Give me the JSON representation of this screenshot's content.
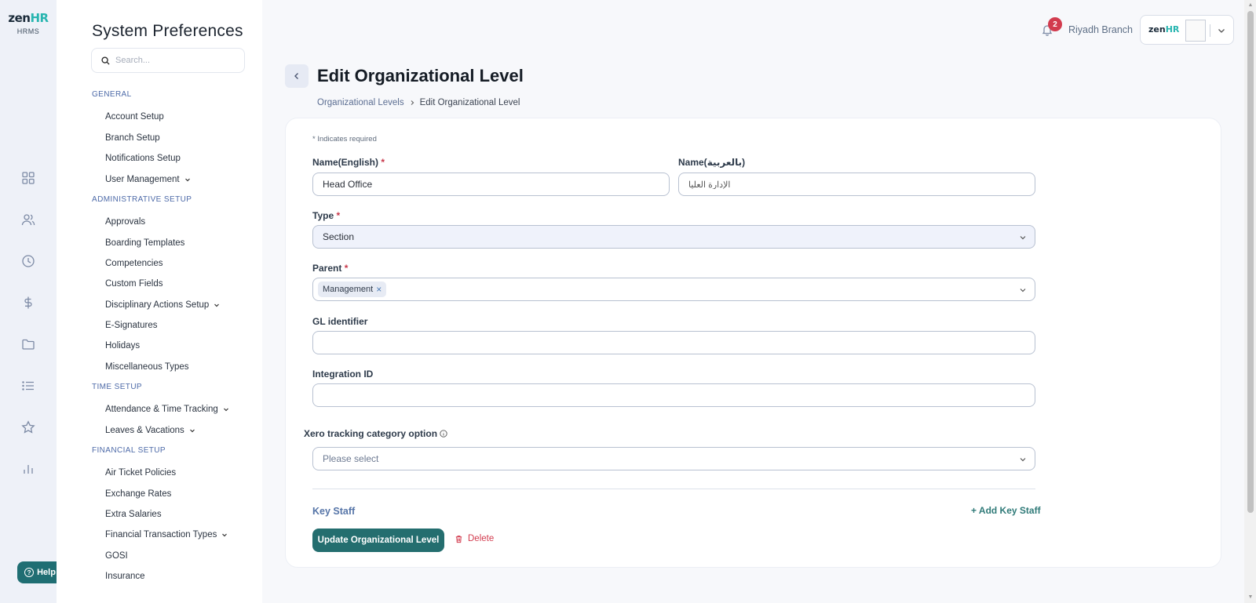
{
  "brand": {
    "logo_main": "zen",
    "logo_accent": "HR",
    "logo_sub": "HRMS"
  },
  "rail": {
    "items": [
      "dashboard-icon",
      "people-icon",
      "clock-icon",
      "dollar-icon",
      "folder-icon",
      "list-icon",
      "star-icon",
      "bar-chart-icon"
    ]
  },
  "help": {
    "label": "Help"
  },
  "sidebar": {
    "title": "System Preferences",
    "search_placeholder": "Search...",
    "sections": {
      "general": {
        "heading": "GENERAL",
        "items": [
          "Account Setup",
          "Branch Setup",
          "Notifications Setup",
          "User Management"
        ]
      },
      "administrative": {
        "heading": "ADMINISTRATIVE SETUP",
        "items": [
          "Approvals",
          "Boarding Templates",
          "Competencies",
          "Custom Fields",
          "Disciplinary Actions Setup",
          "E-Signatures",
          "Holidays",
          "Miscellaneous Types"
        ]
      },
      "time": {
        "heading": "TIME SETUP",
        "items": [
          "Attendance & Time Tracking",
          "Leaves & Vacations"
        ]
      },
      "financial": {
        "heading": "FINANCIAL SETUP",
        "items": [
          "Air Ticket Policies",
          "Exchange Rates",
          "Extra Salaries",
          "Financial Transaction Types",
          "GOSI",
          "Insurance"
        ]
      }
    }
  },
  "topbar": {
    "notification_count": "2",
    "branch": "Riyadh Branch",
    "account_logo_main": "zen",
    "account_logo_accent": "HR"
  },
  "page": {
    "title": "Edit Organizational Level",
    "breadcrumb": {
      "parent": "Organizational Levels",
      "current": "Edit Organizational Level"
    }
  },
  "form": {
    "required_note": "* Indicates required",
    "name_en": {
      "label": "Name(English)",
      "value": "Head Office"
    },
    "name_ar": {
      "label": "Name(بالعربية)",
      "value": "الإدارة العليا"
    },
    "type": {
      "label": "Type",
      "value": "Section"
    },
    "parent": {
      "label": "Parent",
      "chip": "Management"
    },
    "gl_identifier": {
      "label": "GL identifier",
      "value": ""
    },
    "integration_id": {
      "label": "Integration ID",
      "value": ""
    },
    "xero": {
      "label": "Xero tracking category option",
      "placeholder": "Please select"
    },
    "key_staff": {
      "label": "Key Staff",
      "add_label": "+ Add Key Staff"
    },
    "actions": {
      "update_label": "Update Organizational Level",
      "delete_label": "Delete"
    }
  },
  "colors": {
    "primary_button": "#246e6f",
    "danger": "#d23b4e",
    "accent_link": "#5675a8",
    "brand_teal": "#28b5b0"
  }
}
